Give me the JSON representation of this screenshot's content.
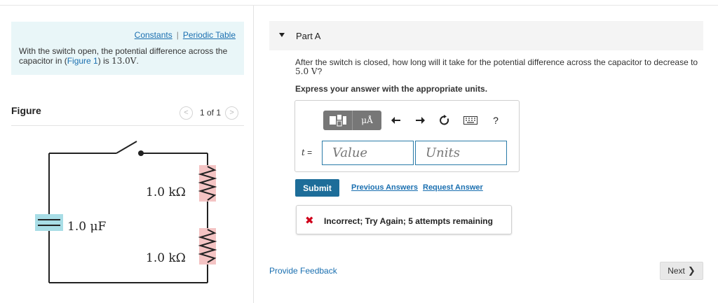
{
  "left": {
    "links": {
      "constants": "Constants",
      "separator": "|",
      "periodic_table": "Periodic Table"
    },
    "intro": {
      "before": "With the switch open, the potential difference across the capacitor in (",
      "figure_link": "Figure 1",
      "middle": ") is ",
      "value": "13.0V",
      "after": "."
    },
    "figure": {
      "title": "Figure",
      "page_indicator": "1 of 1",
      "resistor_top_label": "1.0 kΩ",
      "resistor_bottom_label": "1.0 kΩ",
      "capacitor_label": "1.0 μF"
    }
  },
  "part": {
    "title": "Part A",
    "question_before": "After the switch is closed, how long will it take for the potential difference across the capacitor to decrease to ",
    "question_value": "5.0 V",
    "question_after": "?",
    "instruction": "Express your answer with the appropriate units.",
    "toolbar": {
      "units_symbol": "μÅ",
      "help": "?"
    },
    "variable_label": "t",
    "equals": "=",
    "value_placeholder": "Value",
    "units_placeholder": "Units",
    "submit_label": "Submit",
    "previous_answers": "Previous Answers",
    "request_answer": "Request Answer",
    "feedback_icon": "✖",
    "feedback_message": "Incorrect; Try Again; 5 attempts remaining"
  },
  "footer": {
    "provide_feedback": "Provide Feedback",
    "next_label": "Next",
    "next_icon": "❯"
  },
  "colors": {
    "link": "#1a6fb0",
    "submit_bg": "#1d6d99",
    "error": "#d0021b",
    "info_bg": "#e9f6f8",
    "resistor_fill": "#f4c4c4",
    "capacitor_fill": "#a8dde6"
  }
}
